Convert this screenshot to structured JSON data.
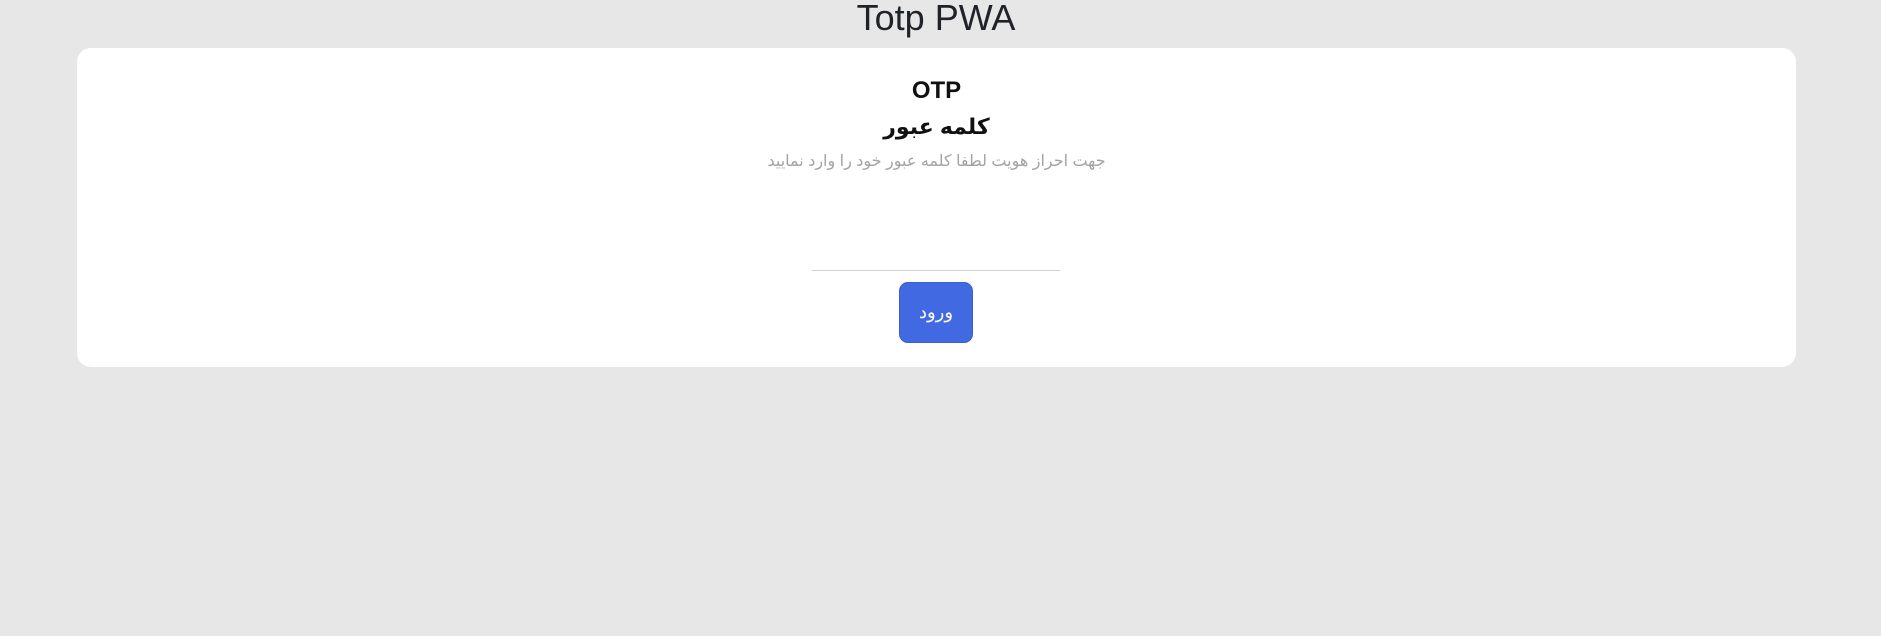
{
  "app": {
    "title": "Totp PWA"
  },
  "card": {
    "otp_title": "OTP",
    "password_title": "کلمه عبور",
    "hint": "جهت احراز هویت لطفا کلمه عبور خود را وارد نمایید",
    "password_input": {
      "value": "",
      "placeholder": ""
    },
    "login_button_label": "ورود"
  },
  "colors": {
    "background": "#e7e7e7",
    "card": "#ffffff",
    "button": "#4169e1",
    "hint_text": "#a3a3a3"
  }
}
